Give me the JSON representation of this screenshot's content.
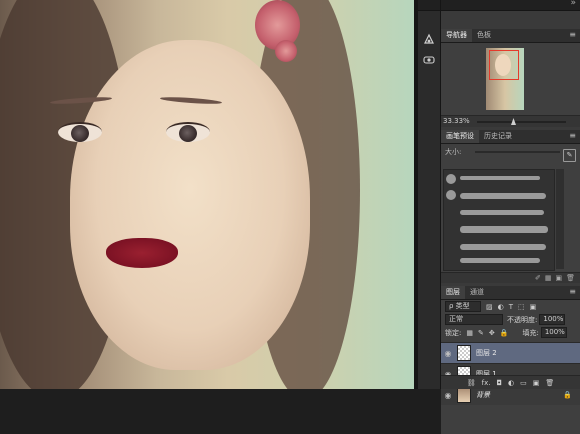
{
  "navigator": {
    "tabs": [
      "导航器",
      "色板"
    ],
    "zoom": "33.33%"
  },
  "brush": {
    "tabs": [
      "画笔预设",
      "历史记录"
    ],
    "size_label": "大小:"
  },
  "layers": {
    "tabs": [
      "图层",
      "通道"
    ],
    "filter": "ρ 类型",
    "blend_mode": "正常",
    "opacity_label": "不透明度:",
    "opacity": "100%",
    "lock_label": "锁定:",
    "fill_label": "填充:",
    "fill": "100%",
    "items": [
      {
        "name": "图层 2",
        "selected": true
      },
      {
        "name": "图层 1",
        "selected": false
      },
      {
        "name": "背景",
        "selected": false
      }
    ]
  }
}
